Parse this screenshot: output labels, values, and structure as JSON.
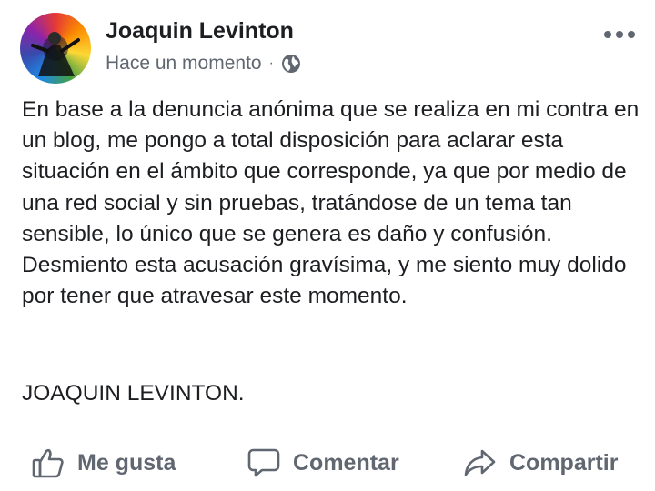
{
  "post": {
    "author": "Joaquin Levinton",
    "timestamp": "Hace un momento",
    "separator": "·",
    "audience_icon": "globe-icon",
    "more_icon": "more-horizontal-icon",
    "avatar": "profile-photo",
    "paragraph": "En base a la denuncia anónima que se realiza en mi contra en un blog, me pongo a total disposición para aclarar esta situación en el ámbito que corresponde, ya que por medio de una red social y sin pruebas, tratándose de un tema tan sensible, lo único que se genera es daño y confusión. Desmiento esta acusación gravísima, y me siento muy dolido por tener que atravesar este momento.",
    "signature": "JOAQUIN LEVINTON."
  },
  "actions": {
    "like": {
      "label": "Me gusta",
      "icon": "thumbs-up-icon"
    },
    "comment": {
      "label": "Comentar",
      "icon": "comment-icon"
    },
    "share": {
      "label": "Compartir",
      "icon": "share-icon"
    }
  },
  "colors": {
    "text": "#1c1e21",
    "secondary": "#616770",
    "action": "#606770",
    "divider": "#dadde1"
  }
}
